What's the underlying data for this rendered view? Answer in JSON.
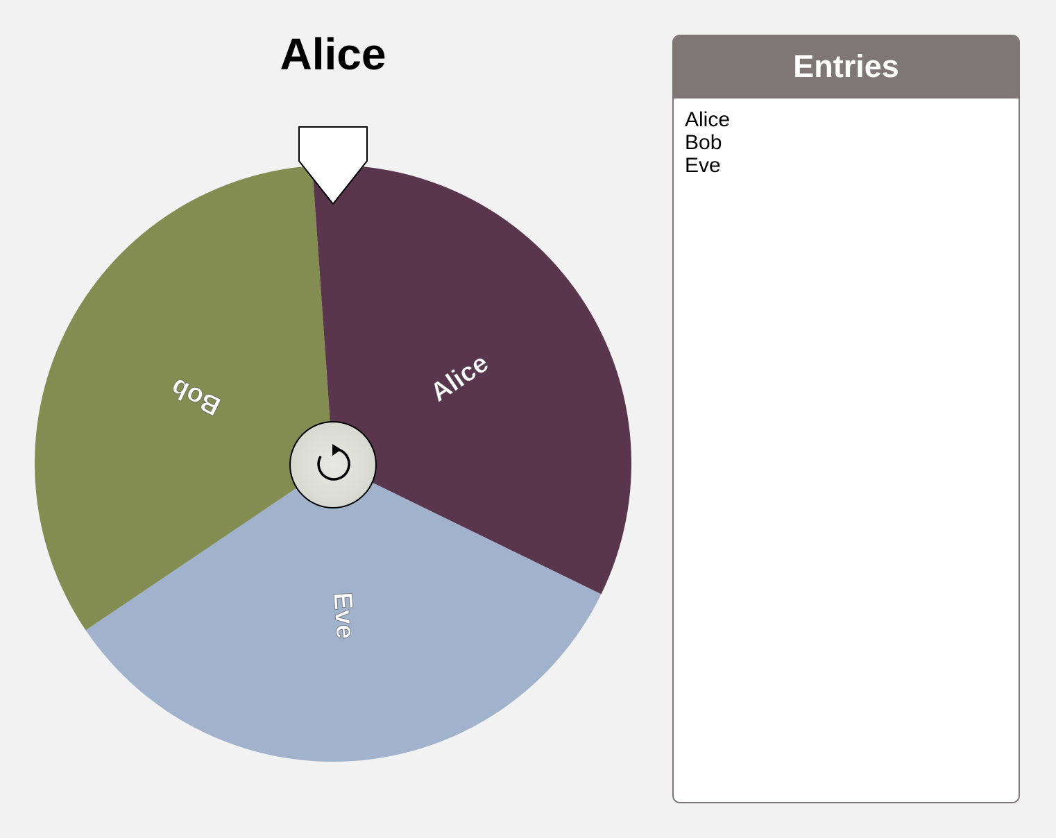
{
  "winner": "Alice",
  "wheel": {
    "segments": [
      {
        "label": "Alice",
        "color": "#5a354e"
      },
      {
        "label": "Eve",
        "color": "#a0b2cc"
      },
      {
        "label": "Bob",
        "color": "#838c51"
      }
    ],
    "spin_icon": "refresh-icon",
    "pointer_icon": "pointer-arrow-icon"
  },
  "entries": {
    "title": "Entries",
    "items": [
      "Alice",
      "Bob",
      "Eve"
    ]
  },
  "colors": {
    "background": "#f2f2f2",
    "panel_header": "#7f7677",
    "panel_border": "#7b7576"
  }
}
